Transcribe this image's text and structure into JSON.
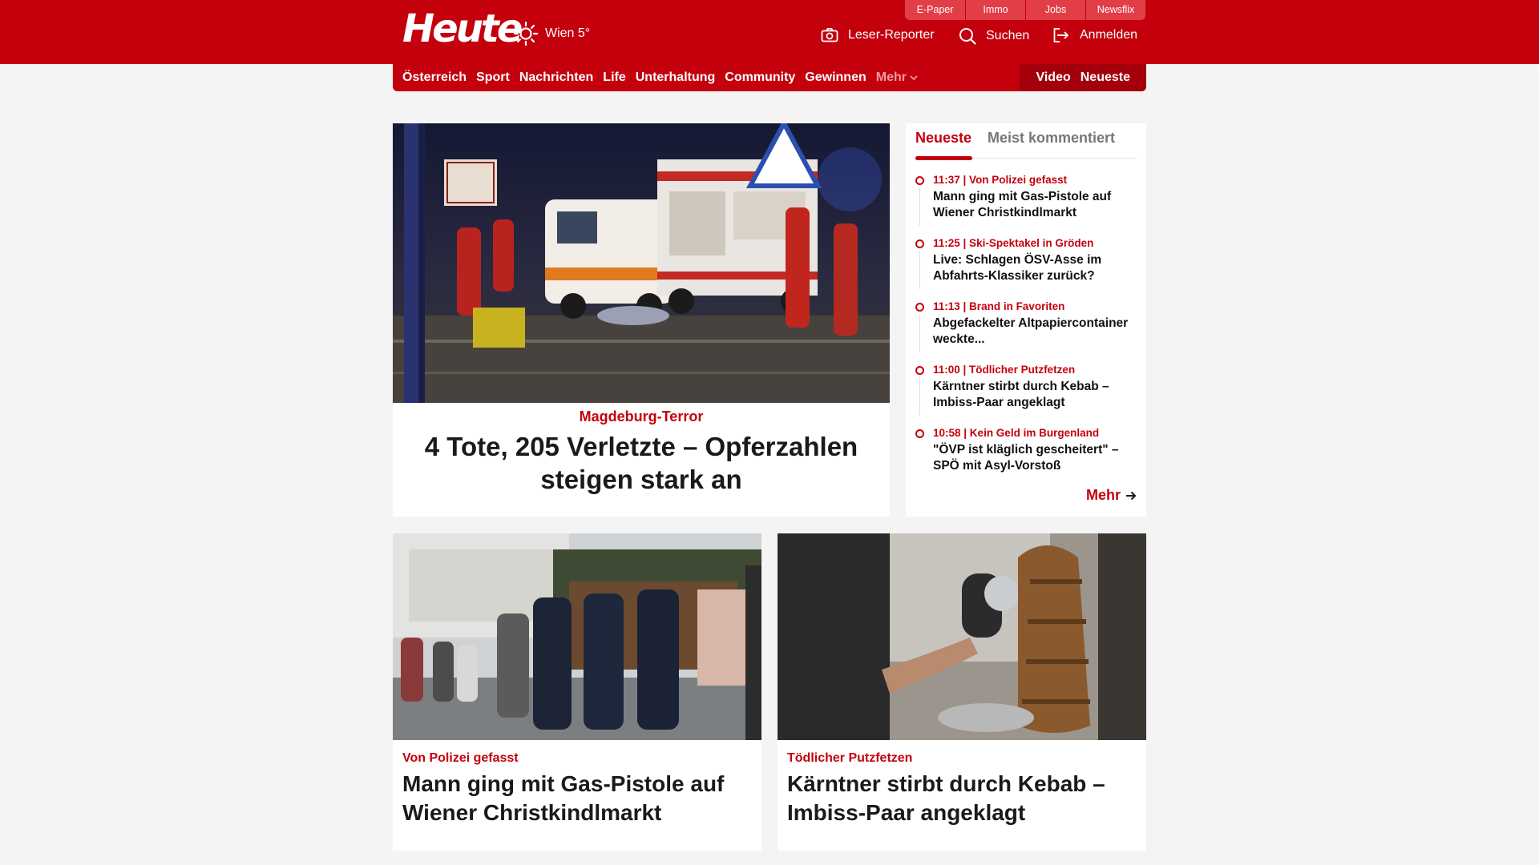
{
  "header": {
    "logo_text": "Heute",
    "weather_text": "Wien 5°",
    "mini_tabs": [
      "E-Paper",
      "Immo",
      "Jobs",
      "Newsflix"
    ],
    "reporter_label": "Leser-Reporter",
    "search_label": "Suchen",
    "login_label": "Anmelden"
  },
  "nav": {
    "items": [
      "Österreich",
      "Sport",
      "Nachrichten",
      "Life",
      "Unterhaltung",
      "Community",
      "Gewinnen"
    ],
    "more_label": "Mehr",
    "video_label": "Video",
    "latest_label": "Neueste"
  },
  "hero": {
    "kicker": "Magdeburg-Terror",
    "title": "4 Tote, 205 Verletzte – Opferzahlen steigen stark an"
  },
  "sidebar": {
    "tab_active": "Neueste",
    "tab_inactive": "Meist kommentiert",
    "items": [
      {
        "meta": "11:37 | Von Polizei gefasst",
        "title": "Mann ging mit Gas-Pistole auf Wiener Christkindlmarkt"
      },
      {
        "meta": "11:25 | Ski-Spektakel in Gröden",
        "title": "Live: Schlagen ÖSV-Asse im Abfahrts-Klassiker zurück?"
      },
      {
        "meta": "11:13 | Brand in Favoriten",
        "title": "Abgefackelter Altpapiercontainer weckte..."
      },
      {
        "meta": "11:00 | Tödlicher Putzfetzen",
        "title": "Kärntner stirbt durch Kebab – Imbiss-Paar angeklagt"
      },
      {
        "meta": "10:58 | Kein Geld im Burgenland",
        "title": "\"ÖVP ist kläglich gescheitert\" – SPÖ mit Asyl-Vorstoß"
      }
    ],
    "more_label": "Mehr"
  },
  "cards": [
    {
      "kicker": "Von Polizei gefasst",
      "title": "Mann ging mit Gas-Pistole auf Wiener Christkindlmarkt"
    },
    {
      "kicker": "Tödlicher Putzfetzen",
      "title": "Kärntner stirbt durch Kebab – Imbiss-Paar angeklagt"
    }
  ],
  "colors": {
    "brand": "#c4000d",
    "brand_dark": "#a3000b",
    "page_bg": "#f4f4f4"
  }
}
